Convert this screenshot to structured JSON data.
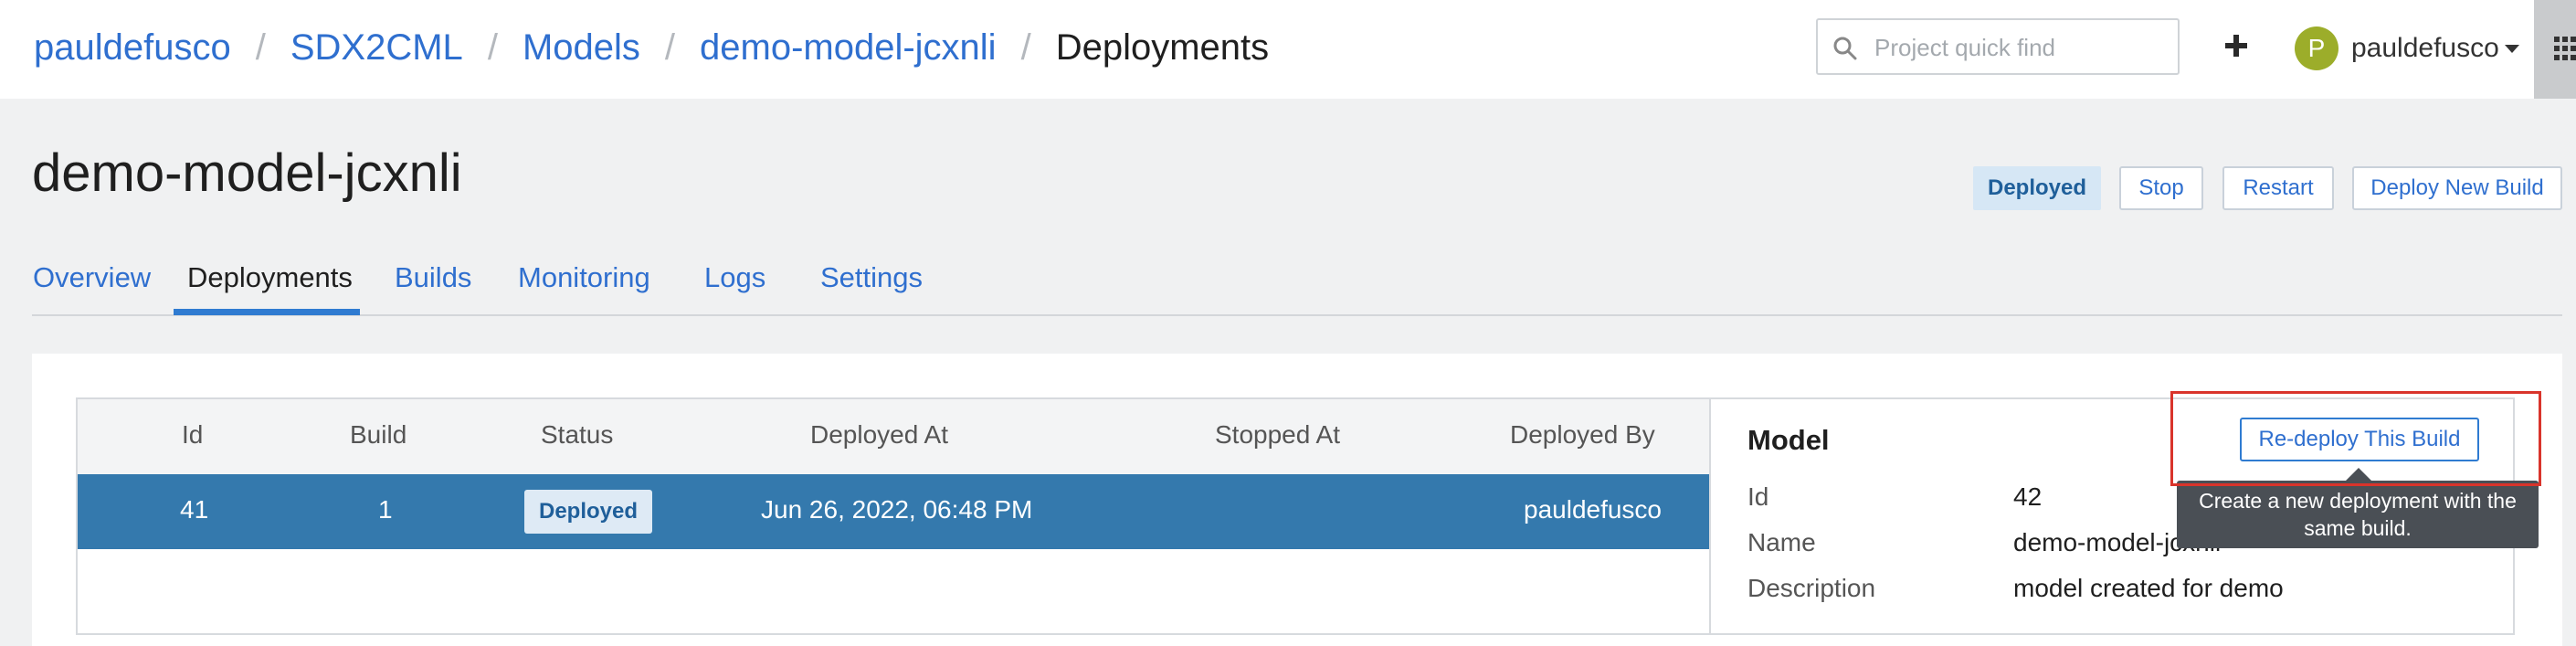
{
  "breadcrumb": {
    "items": [
      "pauldefusco",
      "SDX2CML",
      "Models",
      "demo-model-jcxnli"
    ],
    "separator": "/",
    "current": "Deployments"
  },
  "search": {
    "placeholder": "Project quick find",
    "value": "",
    "icon": "search-icon"
  },
  "header": {
    "add_icon": "plus-icon",
    "user": {
      "initial": "P",
      "name": "pauldefusco",
      "avatar_color": "#9cad2a"
    },
    "apps_icon": "grid-icon"
  },
  "page": {
    "title": "demo-model-jcxnli",
    "status_badge": "Deployed",
    "actions": {
      "stop": "Stop",
      "restart": "Restart",
      "deploy_new_build": "Deploy New Build"
    }
  },
  "tabs": [
    {
      "label": "Overview",
      "active": false
    },
    {
      "label": "Deployments",
      "active": true
    },
    {
      "label": "Builds",
      "active": false
    },
    {
      "label": "Monitoring",
      "active": false
    },
    {
      "label": "Logs",
      "active": false
    },
    {
      "label": "Settings",
      "active": false
    }
  ],
  "deployments_table": {
    "columns": [
      "Id",
      "Build",
      "Status",
      "Deployed At",
      "Stopped At",
      "Deployed By"
    ],
    "rows": [
      {
        "id": "41",
        "build": "1",
        "status": "Deployed",
        "deployed_at": "Jun 26, 2022, 06:48 PM",
        "stopped_at": "",
        "deployed_by": "pauldefusco",
        "selected": true
      }
    ]
  },
  "model_panel": {
    "title": "Model",
    "redeploy_button": "Re-deploy This Build",
    "tooltip": "Create a new deployment with the same build.",
    "fields": [
      {
        "label": "Id",
        "value": "42"
      },
      {
        "label": "Name",
        "value": "demo-model-jcxnli"
      },
      {
        "label": "Description",
        "value": "model created for demo"
      }
    ]
  },
  "colors": {
    "link": "#2f6fcf",
    "selected_row": "#3479ad",
    "highlight": "#d9342b",
    "tab_underline": "#2f7bd1"
  }
}
